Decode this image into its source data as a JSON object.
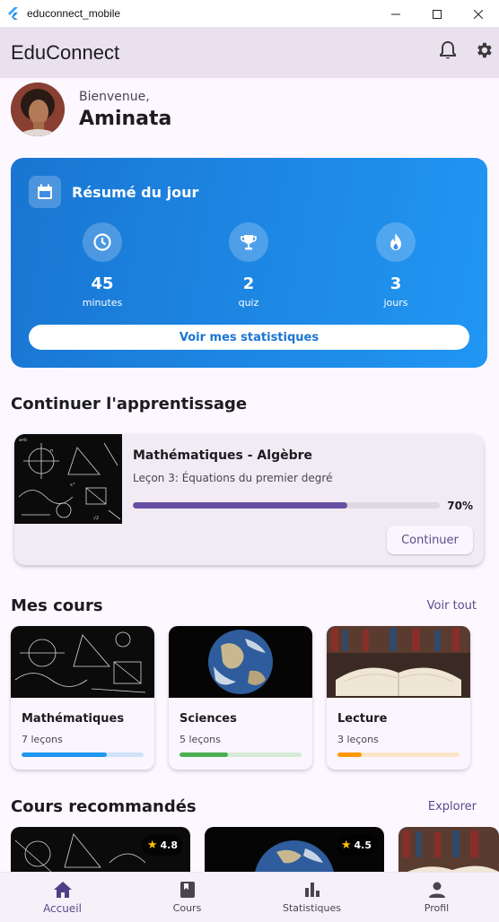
{
  "window": {
    "title": "educonnect_mobile"
  },
  "appbar": {
    "title": "EduConnect",
    "icons": [
      "bell-icon",
      "gear-icon"
    ]
  },
  "greeting": {
    "welcome": "Bienvenue,",
    "name": "Aminata"
  },
  "summary": {
    "title": "Résumé du jour",
    "stats": [
      {
        "icon": "clock-icon",
        "value": "45",
        "label": "minutes"
      },
      {
        "icon": "trophy-icon",
        "value": "2",
        "label": "quiz"
      },
      {
        "icon": "flame-icon",
        "value": "3",
        "label": "jours"
      }
    ],
    "button": "Voir mes statistiques",
    "colors": {
      "start": "#1976d2",
      "end": "#2196f3"
    }
  },
  "continue_section": {
    "title": "Continuer l'apprentissage",
    "course_title": "Mathématiques - Algèbre",
    "lesson": "Leçon 3: Équations du premier degré",
    "progress": 0.7,
    "progress_label": "70%",
    "button": "Continuer"
  },
  "courses": {
    "title": "Mes cours",
    "link": "Voir tout",
    "items": [
      {
        "name": "Mathématiques",
        "lessons": "7 leçons",
        "progress": 0.7,
        "color": "#2196f3",
        "track": "#cfe3fb"
      },
      {
        "name": "Sciences",
        "lessons": "5 leçons",
        "progress": 0.4,
        "color": "#4caf50",
        "track": "#d6ead7"
      },
      {
        "name": "Lecture",
        "lessons": "3 leçons",
        "progress": 0.2,
        "color": "#ff9800",
        "track": "#fbe4c8"
      }
    ]
  },
  "recommended": {
    "title": "Cours recommandés",
    "link": "Explorer",
    "items": [
      {
        "rating": "4.8"
      },
      {
        "rating": "4.5"
      }
    ]
  },
  "bottom_nav": [
    {
      "icon": "home-icon",
      "label": "Accueil",
      "active": true
    },
    {
      "icon": "book-icon",
      "label": "Cours",
      "active": false
    },
    {
      "icon": "bar-chart-icon",
      "label": "Statistiques",
      "active": false
    },
    {
      "icon": "person-icon",
      "label": "Profil",
      "active": false
    }
  ]
}
